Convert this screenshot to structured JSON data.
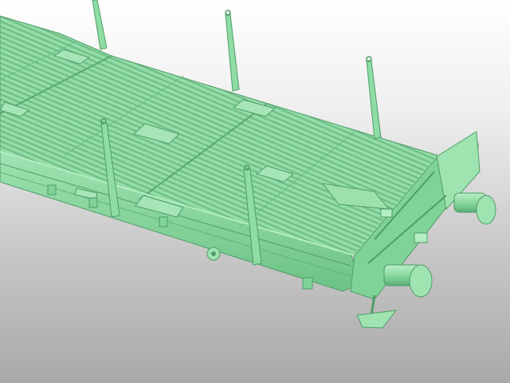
{
  "scene": {
    "subject": "flatcar-3d-model",
    "colors": {
      "body": "#8fdca4",
      "body_light": "#b4edc2",
      "body_mid": "#7fd396",
      "body_dark": "#5fb57b",
      "shadow": "#3f8d58",
      "line": "#4f9d68"
    }
  }
}
